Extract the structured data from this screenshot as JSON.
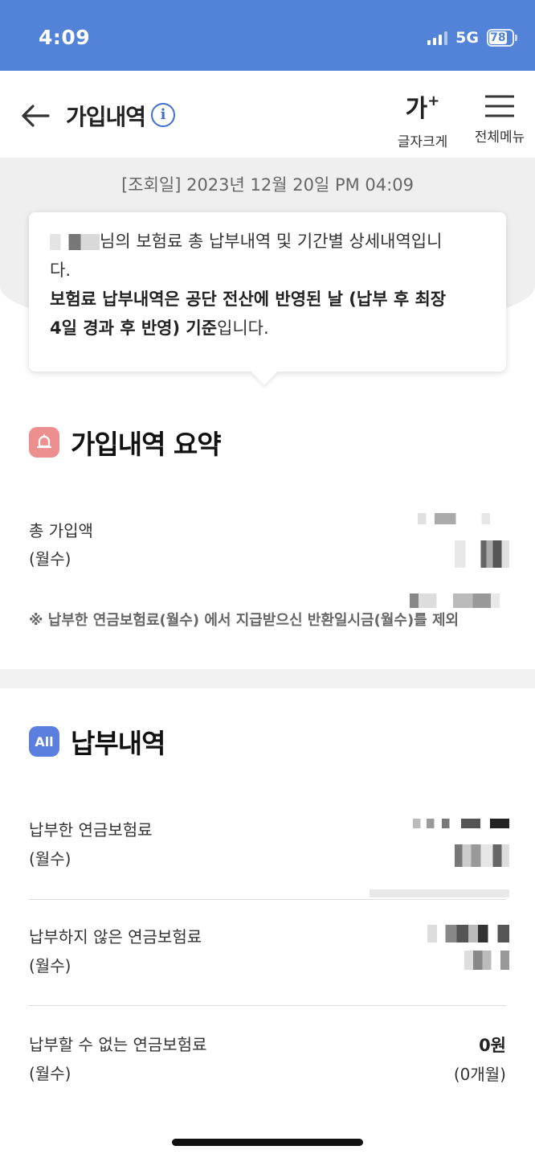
{
  "status_bar": {
    "time": "4:09",
    "network": "5G",
    "battery": "78"
  },
  "header": {
    "title": "가입내역",
    "info_icon": "i",
    "font_size_glyph": "가",
    "font_size_sup": "+",
    "font_size_label": "글자크게",
    "menu_label": "전체메뉴"
  },
  "query_date": "[조회일] 2023년 12월 20일 PM 04:09",
  "notice": {
    "line1": "님의 보험료 총 납부내역 및 기간별 상세내역입니",
    "line1_tail": "다.",
    "bold_line": "보험료 납부내역은 공단 전산에 반영된 날 (납부 후 최장",
    "bold_line2": "4일 경과 후 반영) 기준",
    "line_end": "입니다."
  },
  "summary": {
    "title": "가입내역 요약",
    "total_label": "총 가입액",
    "total_unit": "(월수)",
    "note": "※ 납부한 연금보험료(월수) 에서 지급받으신 반환일시금(월수)를 제외"
  },
  "payments": {
    "title": "납부내역",
    "badge": "All",
    "rows": [
      {
        "label": "납부한 연금보험료",
        "unit": "(월수)"
      },
      {
        "label": "납부하지 않은 연금보험료",
        "unit": "(월수)"
      },
      {
        "label": "납부할 수 없는 연금보험료",
        "unit": "(월수)",
        "amount": "0원",
        "months": "(0개월)"
      }
    ]
  },
  "icons": {
    "back": "arrow-left-icon",
    "info": "info-icon",
    "font": "font-size-icon",
    "menu": "hamburger-menu-icon",
    "summary": "bell-icon",
    "payments": "all-icon"
  },
  "colors": {
    "status_bar": "#5283d8",
    "accent": "#3f6fd1",
    "summary_icon": "#ee8f8f",
    "payments_icon": "#5b7fdf"
  }
}
